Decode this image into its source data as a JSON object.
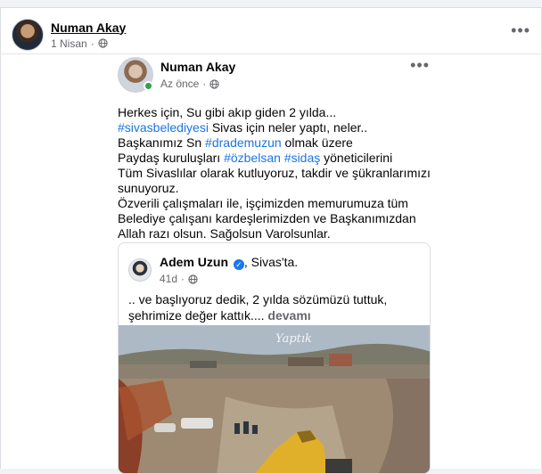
{
  "outer_post": {
    "author": "Numan Akay",
    "date": "1 Nisan",
    "more_label": "•••"
  },
  "inner_post": {
    "author": "Numan Akay",
    "time": "Az önce",
    "more_label": "•••",
    "text": {
      "l1": "Herkes için, Su gibi akıp giden 2 yılda...",
      "l2_tag": "#sivasbelediyesi",
      "l2_rest": " Sivas için neler yaptı, neler..",
      "l3_pre": "Başkanımız Sn ",
      "l3_tag": "#drademuzun",
      "l3_rest": " olmak üzere",
      "l4_pre": "Paydaş kuruluşları ",
      "l4_tag1": "#özbelsan",
      "l4_tag2": "#sidaş",
      "l4_rest": "  yöneticilerini",
      "l5": "Tüm Sivaslılar olarak kutluyoruz, takdir ve şükranlarımızı sunuyoruz.",
      "l6": "Özverili çalışmaları ile, işçimizden memurumuza tüm Belediye çalışanı kardeşlerimizden ve Başkanımızdan Allah razı olsun. Sağolsun Varolsunlar."
    }
  },
  "shared_post": {
    "author": "Adem Uzun",
    "verified_mark": "✓",
    "location_text": ", Sivas'ta.",
    "age": "41d",
    "text": ".. ve başlıyoruz dedik, 2 yılda sözümüzü tuttuk, şehrimize değer kattık....",
    "see_more": "devamı",
    "photo_caption": "Yaptık"
  },
  "colors": {
    "hashtag": "#1b74e4",
    "verified": "#1877f2",
    "online": "#31a24c",
    "meta": "#65676b"
  },
  "icons": [
    "globe-icon",
    "more-options-icon",
    "verified-badge-icon",
    "online-status-icon"
  ]
}
